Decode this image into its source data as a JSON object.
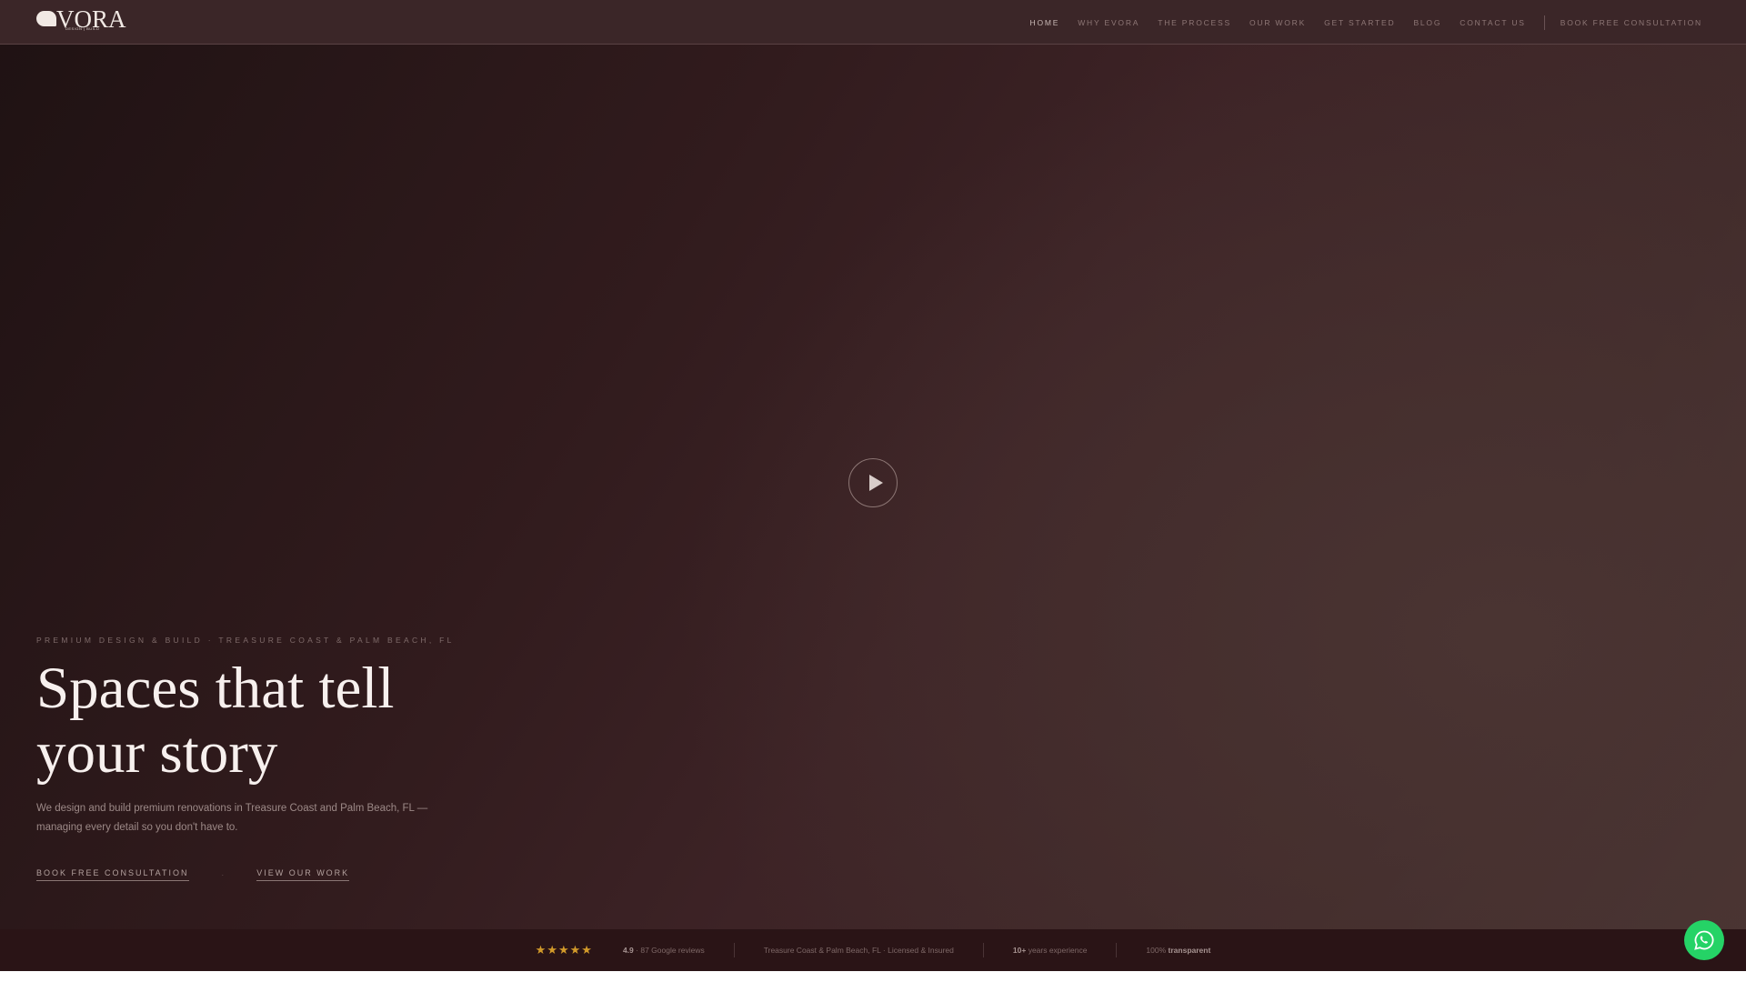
{
  "brand": {
    "name": "VORA",
    "tagline": "DESIGN | BUILD"
  },
  "nav": {
    "items": [
      "HOME",
      "WHY EVORA",
      "THE PROCESS",
      "OUR WORK",
      "GET STARTED",
      "BLOG",
      "CONTACT US"
    ],
    "cta": "BOOK FREE CONSULTATION"
  },
  "hero": {
    "kicker": "PREMIUM DESIGN & BUILD · TREASURE COAST & PALM BEACH, FL",
    "headline_1": "Spaces that tell",
    "headline_2": "your story",
    "description": "We design and build premium renovations in Treasure Coast and Palm Beach, FL — managing every detail so you don't have to.",
    "primary_cta": "BOOK FREE CONSULTATION",
    "separator": "·",
    "secondary_cta": "VIEW OUR WORK"
  },
  "trust": {
    "stars": "★★★★★",
    "rating": "4.9",
    "reviews": "· 87 Google reviews",
    "location": "Treasure Coast & Palm Beach, FL · Licensed & Insured",
    "years_value": "10+",
    "years_label": "years experience",
    "transparent_prefix": "100%",
    "transparent_value": "transparent"
  }
}
